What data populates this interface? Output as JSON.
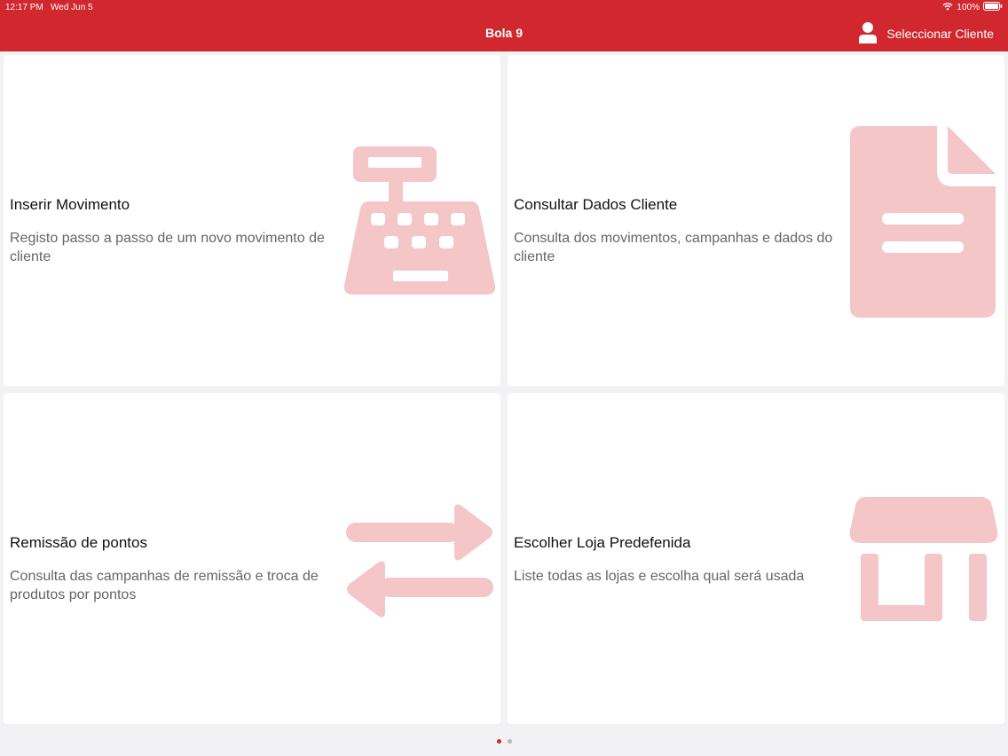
{
  "status_bar": {
    "time": "12:17 PM",
    "date": "Wed Jun 5",
    "battery": "100%"
  },
  "nav": {
    "title": "Bola 9",
    "client_button_label": "Seleccionar Cliente"
  },
  "cards": [
    {
      "title": "Inserir Movimento",
      "description": "Registo passo a passo de um novo movimento de cliente",
      "icon": "cash-register-icon"
    },
    {
      "title": "Consultar Dados Cliente",
      "description": "Consulta dos movimentos, campanhas e dados do cliente",
      "icon": "document-icon"
    },
    {
      "title": "Remissão de pontos",
      "description": "Consulta das campanhas de remissão e troca de produtos por pontos",
      "icon": "exchange-arrows-icon"
    },
    {
      "title": "Escolher Loja Predefenida",
      "description": "Liste todas as lojas e escolha qual será usada",
      "icon": "store-icon"
    }
  ],
  "pager": {
    "page_count": 2,
    "current_page": 1
  },
  "colors": {
    "brand": "#d0282e",
    "icon_tint": "#f4c6c8",
    "active_dot": "#d0282e",
    "inactive_dot": "#b8b8bc"
  }
}
